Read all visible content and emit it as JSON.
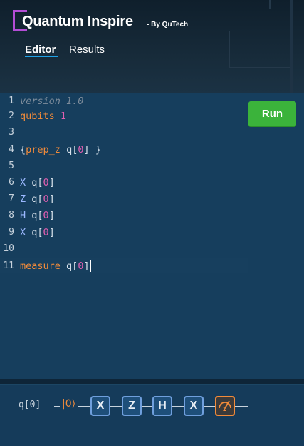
{
  "header": {
    "brand": "Quantum Inspire",
    "brand_sub": "- By QuTech",
    "tabs": [
      {
        "label": "Editor",
        "active": true
      },
      {
        "label": "Results",
        "active": false
      }
    ]
  },
  "editor": {
    "run_label": "Run",
    "lines": [
      {
        "n": "1",
        "text": "version 1.0"
      },
      {
        "n": "2",
        "text": "qubits 1"
      },
      {
        "n": "3",
        "text": ""
      },
      {
        "n": "4",
        "text": "{prep_z q[0] }"
      },
      {
        "n": "5",
        "text": ""
      },
      {
        "n": "6",
        "text": "X q[0]"
      },
      {
        "n": "7",
        "text": "Z q[0]"
      },
      {
        "n": "8",
        "text": "H q[0]"
      },
      {
        "n": "9",
        "text": "X q[0]"
      },
      {
        "n": "10",
        "text": ""
      },
      {
        "n": "11",
        "text": "measure q[0]"
      }
    ]
  },
  "circuit": {
    "qubit_label": "q[0]",
    "prep_label": "|0⟩",
    "gates": [
      "X",
      "Z",
      "H",
      "X"
    ],
    "measure_basis": "z"
  },
  "colors": {
    "keyword": "#f28b3a",
    "number": "#e05fb1",
    "run_button": "#3bb33b",
    "brand_accent": "#b44dd6"
  }
}
